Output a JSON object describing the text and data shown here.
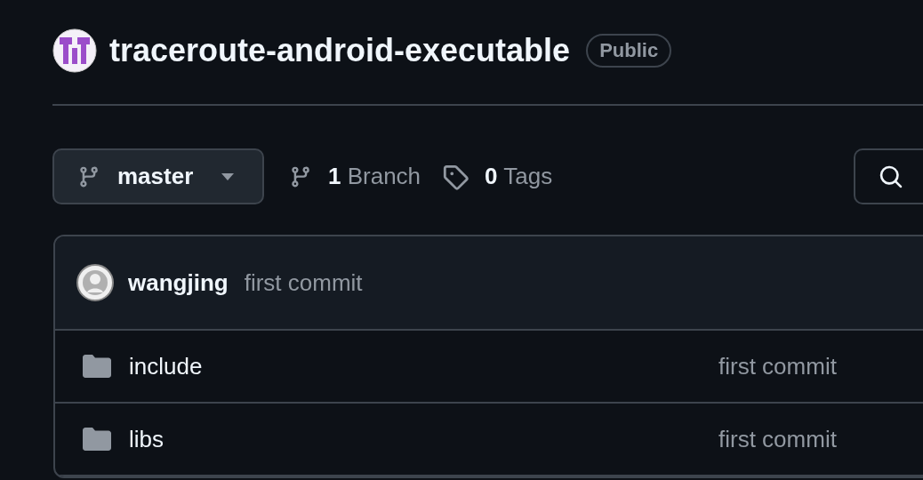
{
  "repo": {
    "name": "traceroute-android-executable",
    "visibility": "Public"
  },
  "branch_bar": {
    "branch": "master",
    "branches_count": "1",
    "branches_label": "Branch",
    "tags_count": "0",
    "tags_label": "Tags"
  },
  "latest_commit": {
    "author": "wangjing",
    "message": "first commit"
  },
  "files": [
    {
      "kind": "folder",
      "name": "include",
      "commit_message": "first commit"
    },
    {
      "kind": "folder",
      "name": "libs",
      "commit_message": "first commit"
    }
  ]
}
